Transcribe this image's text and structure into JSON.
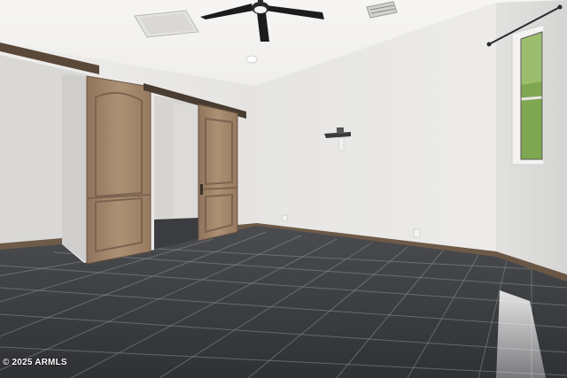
{
  "watermark": {
    "text": "2025 ARMLS"
  },
  "scene": {
    "description_tags": [
      "empty-room",
      "barn-doors",
      "ceiling-fan",
      "tile-floor",
      "window"
    ],
    "colors": {
      "ceiling": "#f3f2f0",
      "wall_back": "#e9e8e6",
      "wall_right": "#dededc",
      "wall_left": "#ecebe9",
      "floor": "#3d3f42",
      "baseboard": "#6e5a48",
      "door_wood": "#a78a6e",
      "door_rail": "#4a3c30",
      "fan": "#1c1c1c",
      "window_green": "#7fa650"
    },
    "icons": [
      "ceiling-fan-icon",
      "vent-icon",
      "recessed-light-icon",
      "shelf-icon",
      "outlet-icon",
      "curtain-rod-icon"
    ]
  }
}
